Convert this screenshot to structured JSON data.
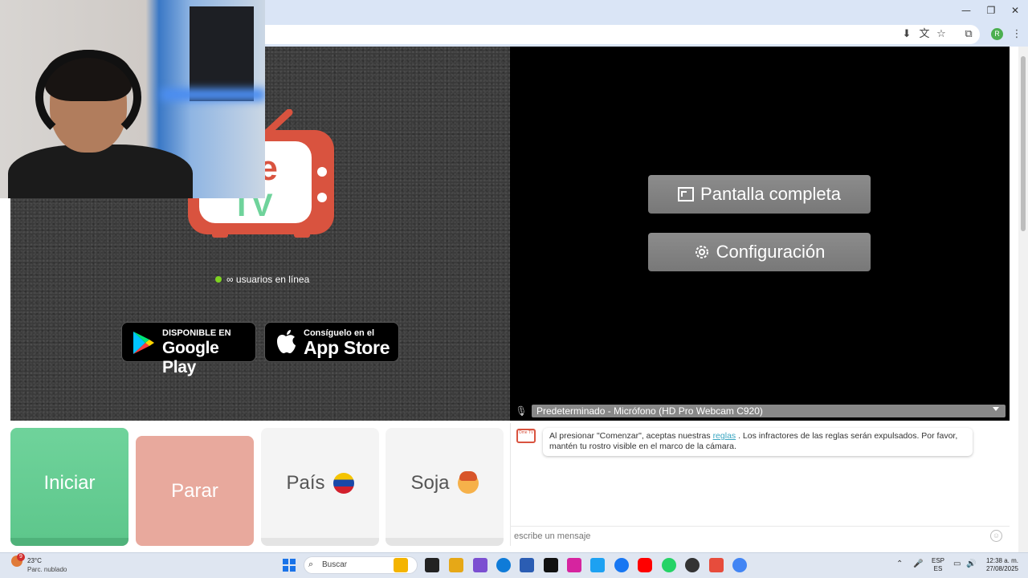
{
  "browser": {
    "window_controls": {
      "minimize": "—",
      "restore": "❐",
      "close": "✕"
    },
    "toolbar_icons": [
      "install-icon",
      "translate-icon",
      "star-icon",
      "extensions-icon",
      "menu-icon"
    ],
    "profile_initial": "R"
  },
  "video": {
    "online_text": "∞ usuarios en línea",
    "logo_word_top": "me",
    "logo_word_bottom": "TV",
    "google_play": {
      "small": "DISPONIBLE EN",
      "big": "Google Play"
    },
    "app_store": {
      "small": "Consíguelo en el",
      "big": "App Store"
    },
    "fullscreen_label": "Pantalla completa",
    "settings_label": "Configuración",
    "mic_selected": "Predeterminado - Micrófono (HD Pro Webcam C920)"
  },
  "controls": {
    "start": "Iniciar",
    "stop": "Parar",
    "country": "País",
    "gender": "Soja"
  },
  "chat": {
    "logo_text": "Ome TV",
    "message_pre": "Al presionar \"Comenzar\", aceptas nuestras",
    "message_link": "reglas",
    "message_post": ". Los infractores de las reglas serán expulsados. Por favor, mantén tu rostro visible en el marco de la cámara.",
    "input_placeholder": "escribe un mensaje"
  },
  "taskbar": {
    "weather_badge": "9",
    "temperature": "23°C",
    "condition": "Parc. nublado",
    "search_label": "Buscar",
    "lang_top": "ESP",
    "lang_bottom": "ES",
    "time": "12:38 a. m.",
    "date": "27/08/2025",
    "app_colors": [
      "#f4b400",
      "#222222",
      "#e6a817",
      "#7b4fd1",
      "#0f7bd8",
      "#2b5db3",
      "#111111",
      "#d6249f",
      "#1da1f2",
      "#1877f2",
      "#ff0000",
      "#25d366",
      "#333333",
      "#e74c3c",
      "#4285f4"
    ]
  }
}
